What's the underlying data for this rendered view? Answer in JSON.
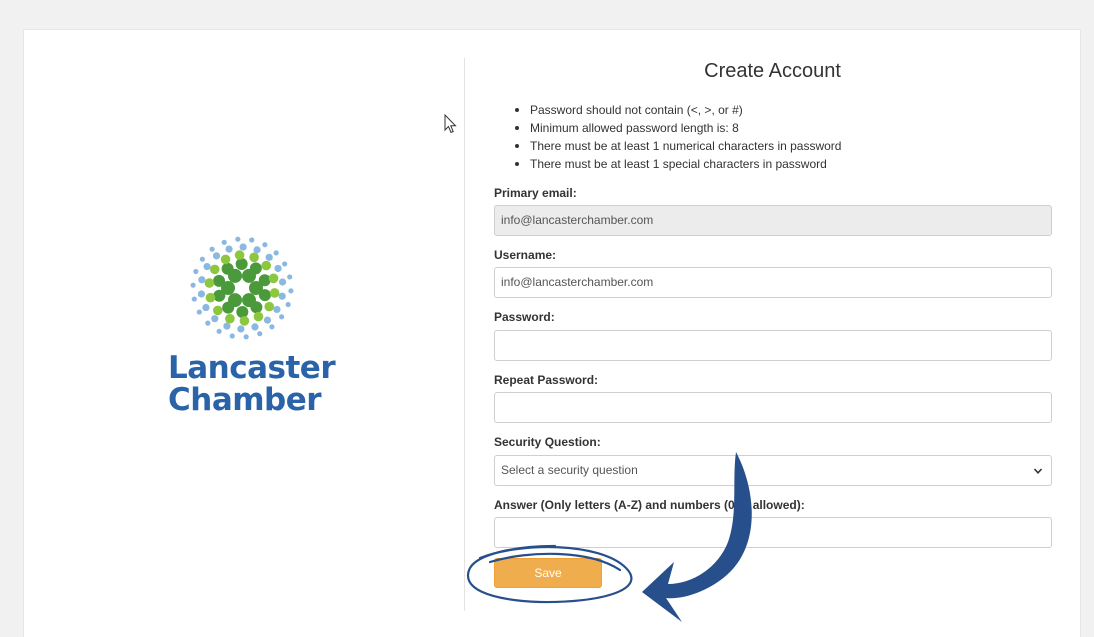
{
  "form": {
    "title": "Create Account",
    "rules": [
      "Password should not contain (<, >, or #)",
      "Minimum allowed password length is: 8",
      "There must be at least 1 numerical characters in password",
      "There must be at least 1 special characters in password"
    ],
    "primary_email": {
      "label": "Primary email:",
      "value": "info@lancasterchamber.com"
    },
    "username": {
      "label": "Username:",
      "value": "info@lancasterchamber.com"
    },
    "password": {
      "label": "Password:",
      "value": ""
    },
    "repeat_password": {
      "label": "Repeat Password:",
      "value": ""
    },
    "security_question": {
      "label": "Security Question:",
      "value": "Select a security question"
    },
    "answer": {
      "label": "Answer (Only letters (A-Z) and numbers (0-9) allowed):",
      "value": ""
    },
    "save_label": "Save"
  },
  "logo": {
    "line1": "Lancaster",
    "line2": "Chamber"
  },
  "colors": {
    "brand_blue": "#2a63a8",
    "logo_green_dark": "#4a9a3c",
    "logo_green_light": "#8dc63f",
    "logo_blue_light": "#8ab8e0",
    "save_button": "#f0ad4e",
    "annotation": "#274f8c"
  },
  "icons": {
    "cursor": "mouse-pointer-icon",
    "select": "chevron-down-icon",
    "annotation": "curved-arrow-icon"
  }
}
